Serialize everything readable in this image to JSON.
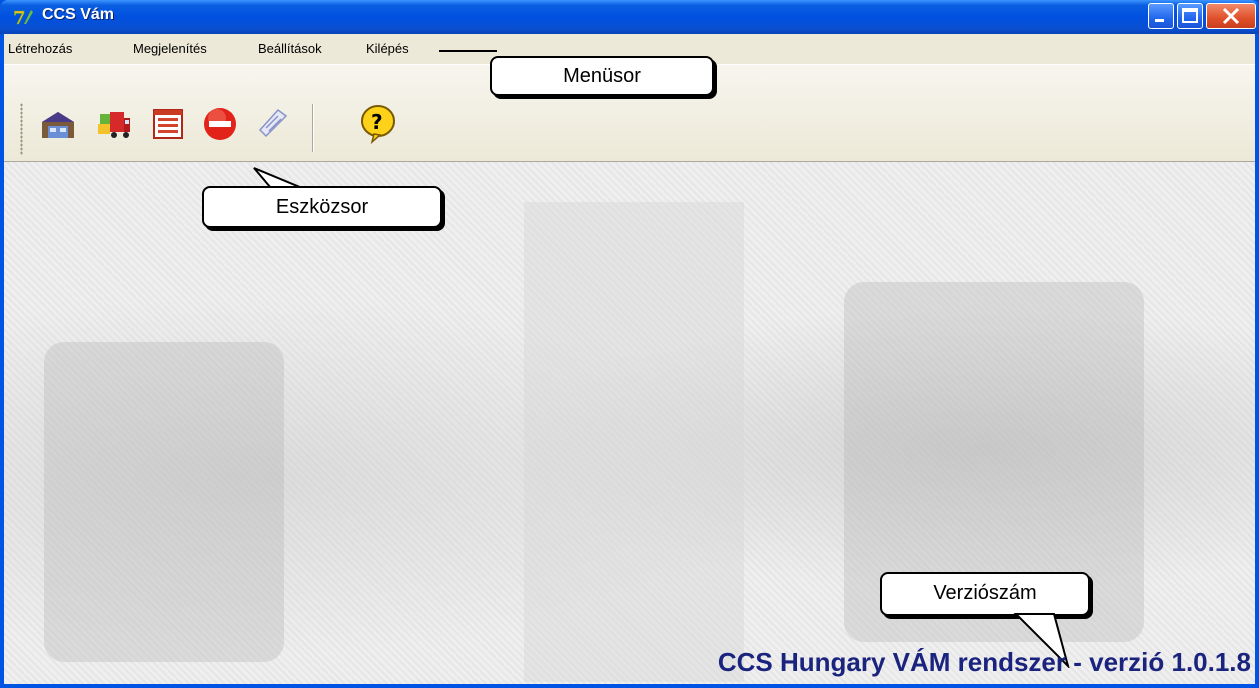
{
  "window": {
    "title": "CCS Vám",
    "icons": {
      "app": "app-logo-icon",
      "minimize": "minimize-icon",
      "maximize": "maximize-icon",
      "close": "close-icon"
    }
  },
  "menu": {
    "items": [
      "Létrehozás",
      "Megjelenítés",
      "Beállítások",
      "Kilépés"
    ]
  },
  "toolbar": {
    "tools": [
      {
        "icon": "warehouse-icon"
      },
      {
        "icon": "truck-icon"
      },
      {
        "icon": "list-icon"
      },
      {
        "icon": "stop-icon"
      },
      {
        "icon": "document-icon"
      },
      {
        "icon": "help-icon"
      }
    ]
  },
  "annotations": {
    "menubar": "Menüsor",
    "toolbar": "Eszközsor",
    "version": "Verziószám"
  },
  "status": {
    "version_text": "CCS Hungary VÁM rendszer - verzió 1.0.1.8"
  },
  "colors": {
    "title_bar": "#0054e3",
    "menu_bg": "#ece9d8",
    "version_text": "#1a237e"
  }
}
